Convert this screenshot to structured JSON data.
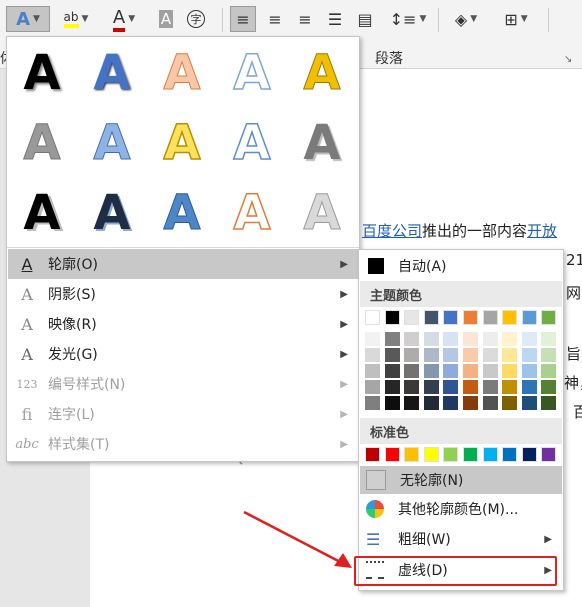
{
  "ribbon": {
    "font_buttons": [
      "A",
      "ab",
      "A",
      "A",
      "字"
    ],
    "para_label": "段落",
    "left_cut": "体",
    "launcher": "↘"
  },
  "doc": {
    "line1_link1": "百度公司",
    "line1_text": "推出的一部内容",
    "line1_link2": "开放",
    "right_frag1": "21",
    "right_frag2": "网",
    "right_frag3": "旨",
    "right_frag4": "神，",
    "right_frag5": "百",
    "return_mark": "↵"
  },
  "menu": {
    "gallery_rows": [
      [
        "A",
        "A",
        "A",
        "A",
        "A"
      ],
      [
        "A",
        "A",
        "A",
        "A",
        "A"
      ],
      [
        "A",
        "A",
        "A",
        "A",
        "A"
      ]
    ],
    "items": [
      {
        "label": "轮廓(O)",
        "icon": "A"
      },
      {
        "label": "阴影(S)",
        "icon": "A"
      },
      {
        "label": "映像(R)",
        "icon": "A"
      },
      {
        "label": "发光(G)",
        "icon": "A"
      },
      {
        "label": "编号样式(N)",
        "icon": "123"
      },
      {
        "label": "连字(L)",
        "icon": "fi"
      },
      {
        "label": "样式集(T)",
        "icon": "abc"
      }
    ]
  },
  "submenu": {
    "auto": "自动(A)",
    "theme_colors": "主题颜色",
    "standard_colors": "标准色",
    "no_outline": "无轮廓(N)",
    "more_colors": "其他轮廓颜色(M)...",
    "weight": "粗细(W)",
    "dashes": "虚线(D)",
    "theme_top": [
      "#ffffff",
      "#000000",
      "#e7e6e6",
      "#44546a",
      "#4472c4",
      "#ed7d31",
      "#a5a5a5",
      "#ffc000",
      "#5b9bd5",
      "#70ad47"
    ],
    "theme_shades": [
      [
        "#f2f2f2",
        "#808080",
        "#d0cece",
        "#d6dce4",
        "#d9e2f3",
        "#fbe5d6",
        "#ededed",
        "#fff2cc",
        "#deebf7",
        "#e2f0d9"
      ],
      [
        "#d9d9d9",
        "#595959",
        "#aeabab",
        "#adb9ca",
        "#b4c7e7",
        "#f8cbad",
        "#dbdbdb",
        "#ffe699",
        "#bdd7ee",
        "#c5e0b4"
      ],
      [
        "#bfbfbf",
        "#404040",
        "#767171",
        "#8497b0",
        "#8faadc",
        "#f4b183",
        "#c9c9c9",
        "#ffd966",
        "#9dc3e6",
        "#a9d18e"
      ],
      [
        "#a6a6a6",
        "#262626",
        "#3b3838",
        "#333f50",
        "#2f5597",
        "#c55a11",
        "#7b7b7b",
        "#bf9000",
        "#2e75b6",
        "#548235"
      ],
      [
        "#7f7f7f",
        "#0d0d0d",
        "#171616",
        "#222a35",
        "#1f3864",
        "#843c0c",
        "#525252",
        "#7f6000",
        "#1f4e79",
        "#385723"
      ]
    ],
    "standard": [
      "#c00000",
      "#ff0000",
      "#ffc000",
      "#ffff00",
      "#92d050",
      "#00b050",
      "#00b0f0",
      "#0070c0",
      "#002060",
      "#7030a0"
    ]
  }
}
